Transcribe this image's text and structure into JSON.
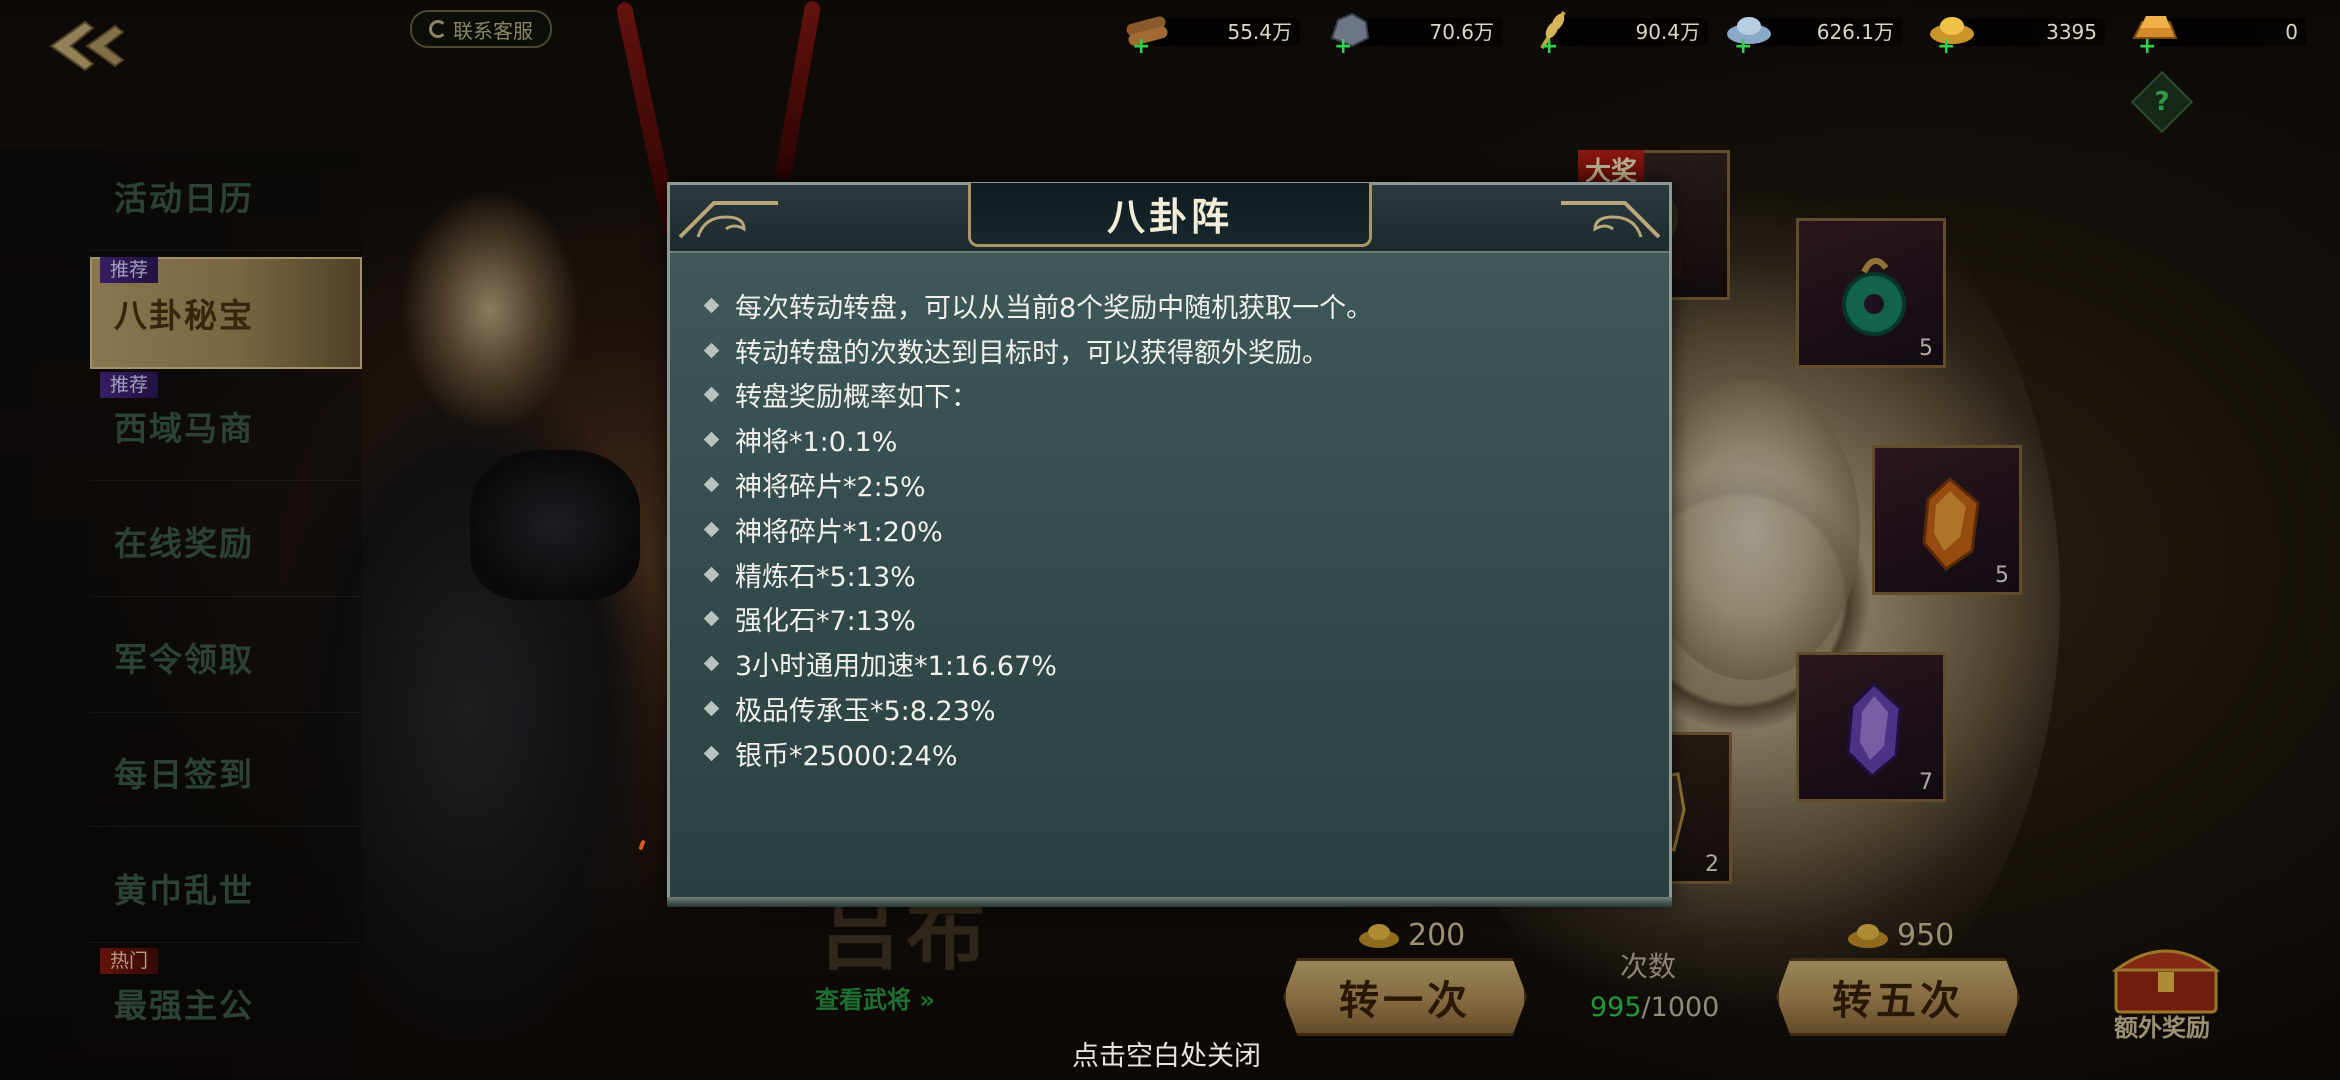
{
  "support": {
    "label": "联系客服"
  },
  "resources": [
    {
      "name": "wood-icon",
      "value": "55.4万"
    },
    {
      "name": "ore-icon",
      "value": "70.6万"
    },
    {
      "name": "grain-icon",
      "value": "90.4万"
    },
    {
      "name": "silver-icon",
      "value": "626.1万"
    },
    {
      "name": "gold-ingot-icon",
      "value": "3395"
    },
    {
      "name": "gold-bar-icon",
      "value": "0"
    }
  ],
  "help": {
    "label": "?"
  },
  "menu": {
    "items": [
      {
        "label": "活动日历",
        "tag": ""
      },
      {
        "label": "八卦秘宝",
        "tag": "推荐",
        "active": true
      },
      {
        "label": "西域马商",
        "tag": "推荐"
      },
      {
        "label": "在线奖励",
        "tag": ""
      },
      {
        "label": "军令领取",
        "tag": ""
      },
      {
        "label": "每日签到",
        "tag": ""
      },
      {
        "label": "黄巾乱世",
        "tag": ""
      },
      {
        "label": "最强主公",
        "tag": "热门"
      }
    ]
  },
  "wheel": {
    "jackpot_label": "大奖",
    "slots": [
      {
        "icon": "jade-pendant-icon",
        "count": "5"
      },
      {
        "icon": "amber-stone-icon",
        "count": "5"
      },
      {
        "icon": "purple-crystal-icon",
        "count": "7"
      },
      {
        "icon": "hero-shard-icon",
        "count": "2"
      }
    ]
  },
  "bottom": {
    "hero_name": "吕布",
    "view_hero": "查看武将 »",
    "spin_once": {
      "label": "转一次",
      "cost": "200"
    },
    "spin_five": {
      "label": "转五次",
      "cost": "950"
    },
    "count_label": "次数",
    "count_current": "995",
    "count_total": "/1000",
    "extra_reward": "额外奖励",
    "close_hint": "点击空白处关闭"
  },
  "modal": {
    "title": "八卦阵",
    "rules": [
      "每次转动转盘，可以从当前8个奖励中随机获取一个。",
      "转动转盘的次数达到目标时，可以获得额外奖励。",
      "转盘奖励概率如下：",
      "神将*1:0.1%",
      "神将碎片*2:5%",
      "神将碎片*1:20%",
      "精炼石*5:13%",
      "强化石*7:13%",
      "3小时通用加速*1:16.67%",
      "极品传承玉*5:8.23%",
      "银币*25000:24%"
    ]
  },
  "colors": {
    "accent_green": "#32d24c",
    "button_gold": "#c8a56a",
    "modal_bg": "#384f50"
  }
}
